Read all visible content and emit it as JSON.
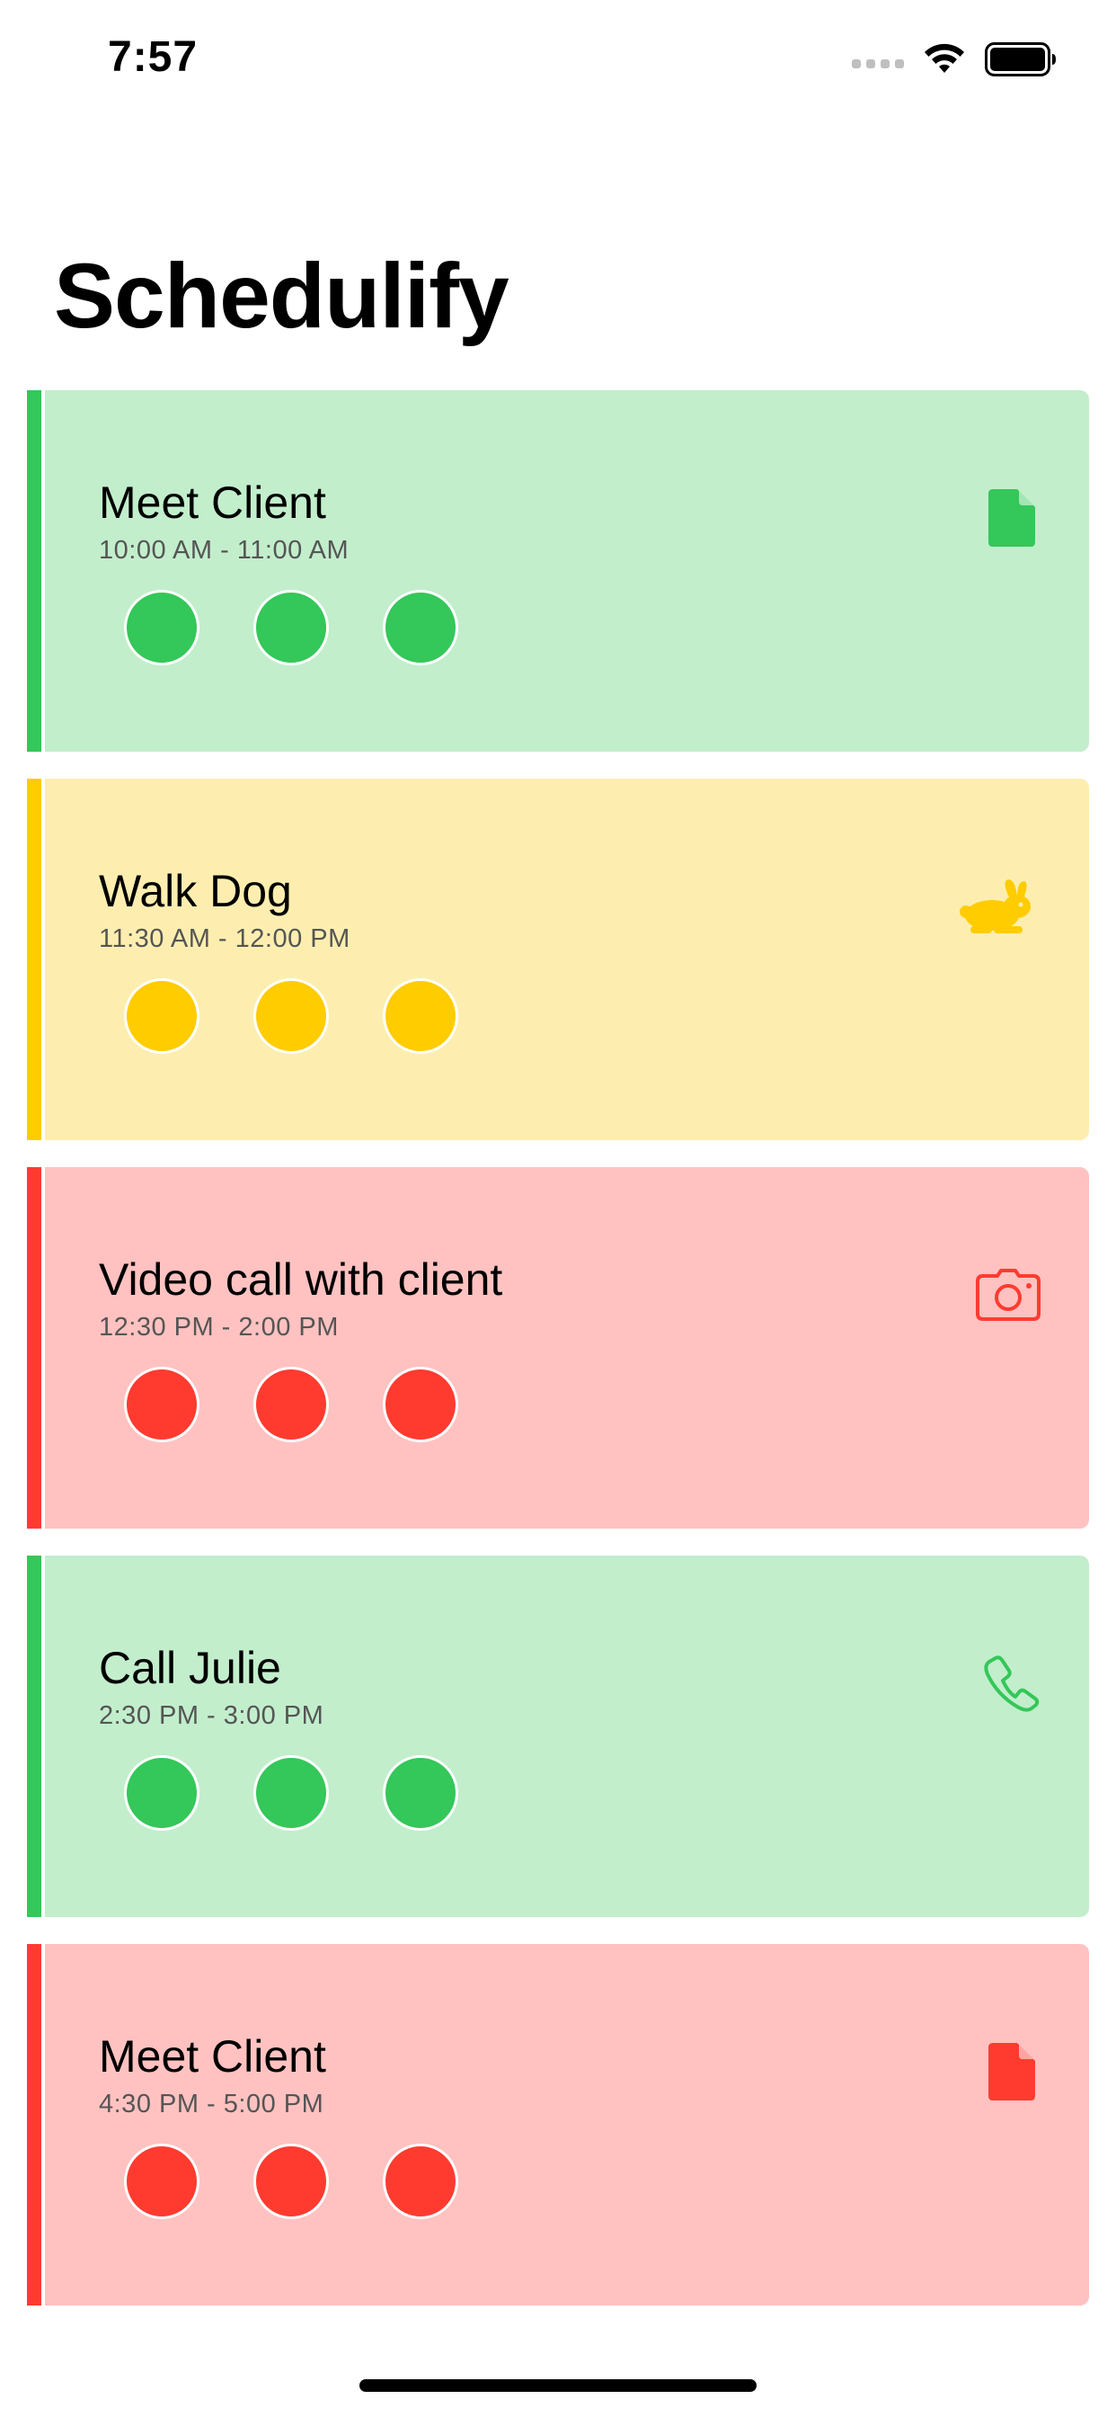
{
  "status_bar": {
    "time": "7:57",
    "icons": [
      "cellular-signal-icon",
      "wifi-icon",
      "battery-icon"
    ]
  },
  "app": {
    "title": "Schedulify"
  },
  "colors": {
    "green": "#34c759",
    "green_bg": "#c2eecc",
    "yellow": "#ffcc00",
    "yellow_bg": "#fdeeb0",
    "red": "#ff3b30",
    "red_bg": "#ffc2c1"
  },
  "events": [
    {
      "title": "Meet Client",
      "time": "10:00 AM - 11:00 AM",
      "color": "#34c759",
      "background": "#c2eecc",
      "icon": "document-icon",
      "attendees": 3
    },
    {
      "title": "Walk Dog",
      "time": "11:30 AM - 12:00 PM",
      "color": "#ffcc00",
      "background": "#fdeeb0",
      "icon": "hare-icon",
      "attendees": 3
    },
    {
      "title": "Video call with client",
      "time": "12:30 PM - 2:00 PM",
      "color": "#ff3b30",
      "background": "#ffc2c1",
      "icon": "camera-icon",
      "attendees": 3
    },
    {
      "title": "Call Julie",
      "time": "2:30 PM - 3:00 PM",
      "color": "#34c759",
      "background": "#c2eecc",
      "icon": "phone-icon",
      "attendees": 3
    },
    {
      "title": "Meet Client",
      "time": "4:30 PM - 5:00 PM",
      "color": "#ff3b30",
      "background": "#ffc2c1",
      "icon": "document-icon",
      "attendees": 3
    }
  ]
}
